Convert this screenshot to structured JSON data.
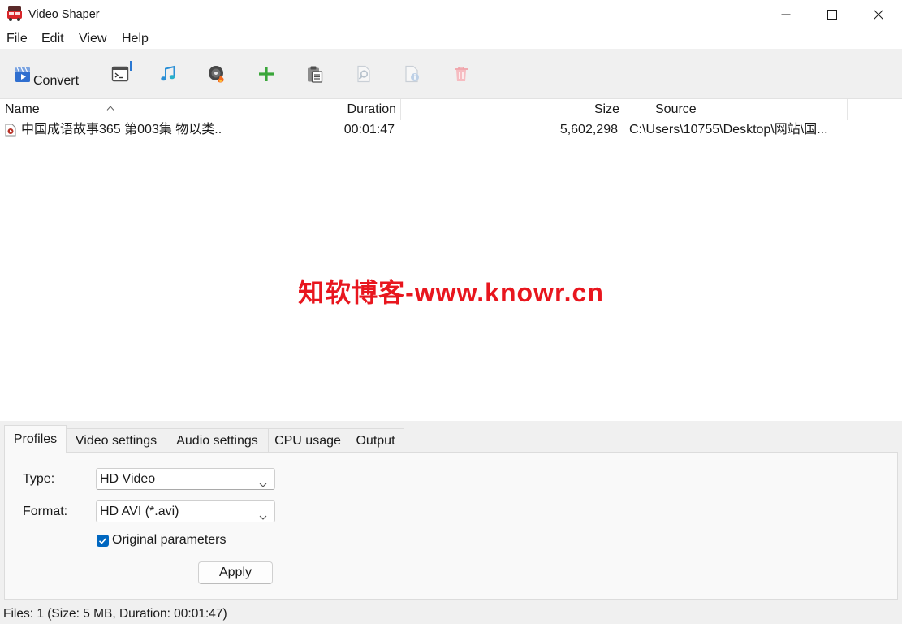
{
  "window": {
    "title": "Video Shaper",
    "icon": "app-logo-icon",
    "controls": [
      "minimize-icon",
      "maximize-icon",
      "close-icon"
    ]
  },
  "menu": [
    "File",
    "Edit",
    "View",
    "Help"
  ],
  "toolbar": {
    "convert": {
      "label": "Convert",
      "icon": "convert-icon",
      "enabled": true
    },
    "buttons": [
      {
        "icon": "console-icon",
        "enabled": true
      },
      {
        "icon": "music-note-icon",
        "enabled": true
      },
      {
        "icon": "burn-disc-icon",
        "enabled": true
      },
      {
        "icon": "add-icon",
        "enabled": true
      },
      {
        "icon": "clipboard-icon",
        "enabled": true
      },
      {
        "icon": "file-search-icon",
        "enabled": false
      },
      {
        "icon": "file-info-icon",
        "enabled": false
      },
      {
        "icon": "trash-icon",
        "enabled": false
      }
    ]
  },
  "file_list": {
    "columns": {
      "name": "Name",
      "duration": "Duration",
      "size": "Size",
      "source": "Source"
    },
    "sort_icon": "sort-ascending-icon",
    "rows": [
      {
        "icon": "video-file-icon",
        "name": "中国成语故事365 第003集 物以类...",
        "duration": "00:01:47",
        "size": "5,602,298",
        "source": "C:\\Users\\10755\\Desktop\\网站\\国..."
      }
    ]
  },
  "watermark": "知软博客-www.knowr.cn",
  "tabs": {
    "items": [
      "Profiles",
      "Video settings",
      "Audio settings",
      "CPU usage",
      "Output"
    ],
    "selected_index": 0
  },
  "profiles": {
    "type_label": "Type:",
    "type_value": "HD Video",
    "format_label": "Format:",
    "format_value": "HD AVI (*.avi)",
    "original_parameters": {
      "label": "Original parameters",
      "checked": true
    },
    "apply_label": "Apply"
  },
  "status_bar": "Files: 1 (Size: 5 MB, Duration: 00:01:47)",
  "colors": {
    "accent": "#0067c0",
    "watermark": "#e8161e",
    "add": "#3aa63a",
    "disabled": "#c9cfd6"
  }
}
